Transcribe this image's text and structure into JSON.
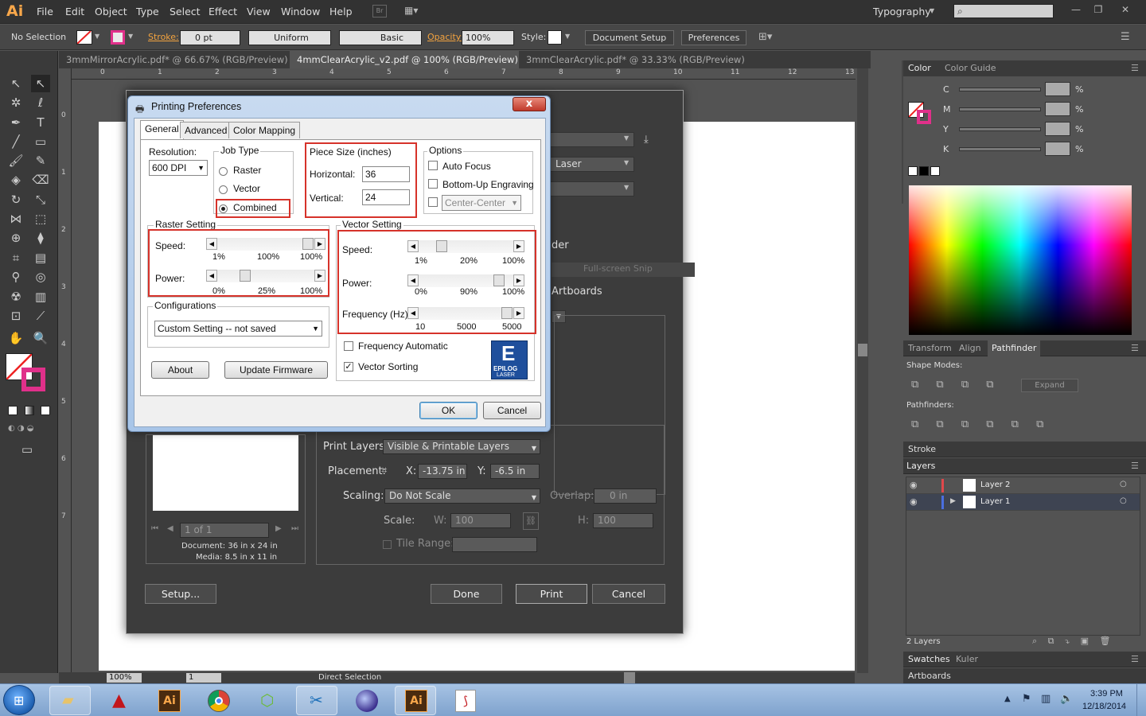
{
  "app": {
    "logo": "Ai",
    "workspace": "Typography"
  },
  "menu": [
    "File",
    "Edit",
    "Object",
    "Type",
    "Select",
    "Effect",
    "View",
    "Window",
    "Help"
  ],
  "control": {
    "selection": "No Selection",
    "stroke_label": "Stroke:",
    "stroke_value": "0 pt",
    "profile1": "Uniform",
    "profile2": "Basic",
    "opacity_label": "Opacity:",
    "opacity_value": "100%",
    "style_label": "Style:",
    "doc_setup": "Document Setup",
    "preferences": "Preferences"
  },
  "tabs": [
    {
      "label": "3mmMirrorAcrylic.pdf* @ 66.67% (RGB/Preview)"
    },
    {
      "label": "4mmClearAcrylic_v2.pdf @ 100% (RGB/Preview)"
    },
    {
      "label": "3mmClearAcrylic.pdf* @ 33.33% (RGB/Preview)"
    }
  ],
  "ruler_h": [
    "0",
    "1",
    "2",
    "3",
    "4",
    "5",
    "6",
    "7",
    "8",
    "9",
    "10",
    "11",
    "12",
    "13"
  ],
  "ruler_v": [
    "0",
    "1",
    "2",
    "3",
    "4",
    "5",
    "6",
    "7"
  ],
  "status": {
    "zoom": "100%",
    "page": "1",
    "tool": "Direct Selection"
  },
  "color_panel": {
    "tab1": "Color",
    "tab2": "Color Guide",
    "channels": [
      {
        "name": "C",
        "unit": "%"
      },
      {
        "name": "M",
        "unit": "%"
      },
      {
        "name": "Y",
        "unit": "%"
      },
      {
        "name": "K",
        "unit": "%"
      }
    ]
  },
  "pathfinder": {
    "tabs": [
      "Transform",
      "Align",
      "Pathfinder"
    ],
    "shape_modes": "Shape Modes:",
    "expand": "Expand",
    "pathfinders": "Pathfinders:"
  },
  "stroke_panel": "Stroke",
  "layers": {
    "title": "Layers",
    "items": [
      {
        "name": "Layer 2",
        "color": "#e0484b"
      },
      {
        "name": "Layer 1",
        "color": "#4a6fe0"
      }
    ],
    "count": "2 Layers"
  },
  "swatches": {
    "tab1": "Swatches",
    "tab2": "Kuler"
  },
  "artboards_panel": "Artboards",
  "print_dialog": {
    "print_layers_label": "Print Layers:",
    "print_layers_value": "Visible & Printable Layers",
    "placement_label": "Placement:",
    "x_label": "X:",
    "x_value": "-13.75 in",
    "y_label": "Y:",
    "y_value": "-6.5 in",
    "scaling_label": "Scaling:",
    "scaling_value": "Do Not Scale",
    "overlap_label": "Overlap:",
    "overlap_value": "0 in",
    "scale_label": "Scale:",
    "w_label": "W:",
    "w_value": "100",
    "h_label": "H:",
    "h_value": "100",
    "tile_range": "Tile Range:",
    "page_nav": "1 of 1",
    "document": "Document: 36 in x 24 in",
    "media": "Media: 8.5 in x 11 in",
    "setup": "Setup...",
    "done": "Done",
    "print": "Print",
    "cancel": "Cancel",
    "laser_text": "Laser",
    "partial_text": "der",
    "artboards_text": "Artboards",
    "snip_text": "Full-screen Snip"
  },
  "pp_dialog": {
    "title": "Printing Preferences",
    "close": "x",
    "tabs": [
      "General",
      "Advanced",
      "Color Mapping"
    ],
    "resolution_label": "Resolution:",
    "resolution_value": "600 DPI",
    "job_type": "Job Type",
    "job_raster": "Raster",
    "job_vector": "Vector",
    "job_combined": "Combined",
    "piece_size": "Piece Size (inches)",
    "horizontal_label": "Horizontal:",
    "horizontal_value": "36",
    "vertical_label": "Vertical:",
    "vertical_value": "24",
    "options": "Options",
    "auto_focus": "Auto Focus",
    "bottom_up": "Bottom-Up Engraving",
    "center": "Center-Center",
    "raster_setting": "Raster Setting",
    "r_speed_label": "Speed:",
    "r_speed": {
      "min": "1%",
      "value": "100%",
      "max": "100%",
      "fraction": 1.0
    },
    "r_power_label": "Power:",
    "r_power": {
      "min": "0%",
      "value": "25%",
      "max": "100%",
      "fraction": 0.25
    },
    "vector_setting": "Vector Setting",
    "v_speed_label": "Speed:",
    "v_speed": {
      "min": "1%",
      "value": "20%",
      "max": "100%",
      "fraction": 0.2
    },
    "v_power_label": "Power:",
    "v_power": {
      "min": "0%",
      "value": "90%",
      "max": "100%",
      "fraction": 0.9
    },
    "v_freq_label": "Frequency (Hz):",
    "v_freq": {
      "min": "10",
      "value": "5000",
      "max": "5000",
      "fraction": 1.0
    },
    "configurations": "Configurations",
    "config_value": "Custom Setting -- not saved",
    "about": "About",
    "update_fw": "Update Firmware",
    "freq_auto": "Frequency Automatic",
    "vector_sorting": "Vector Sorting",
    "logo_e": "E",
    "logo_text1": "EPILOG",
    "logo_text2": "LASER",
    "ok": "OK",
    "cancel": "Cancel"
  },
  "taskbar": {
    "time": "3:39 PM",
    "date": "12/18/2014"
  }
}
